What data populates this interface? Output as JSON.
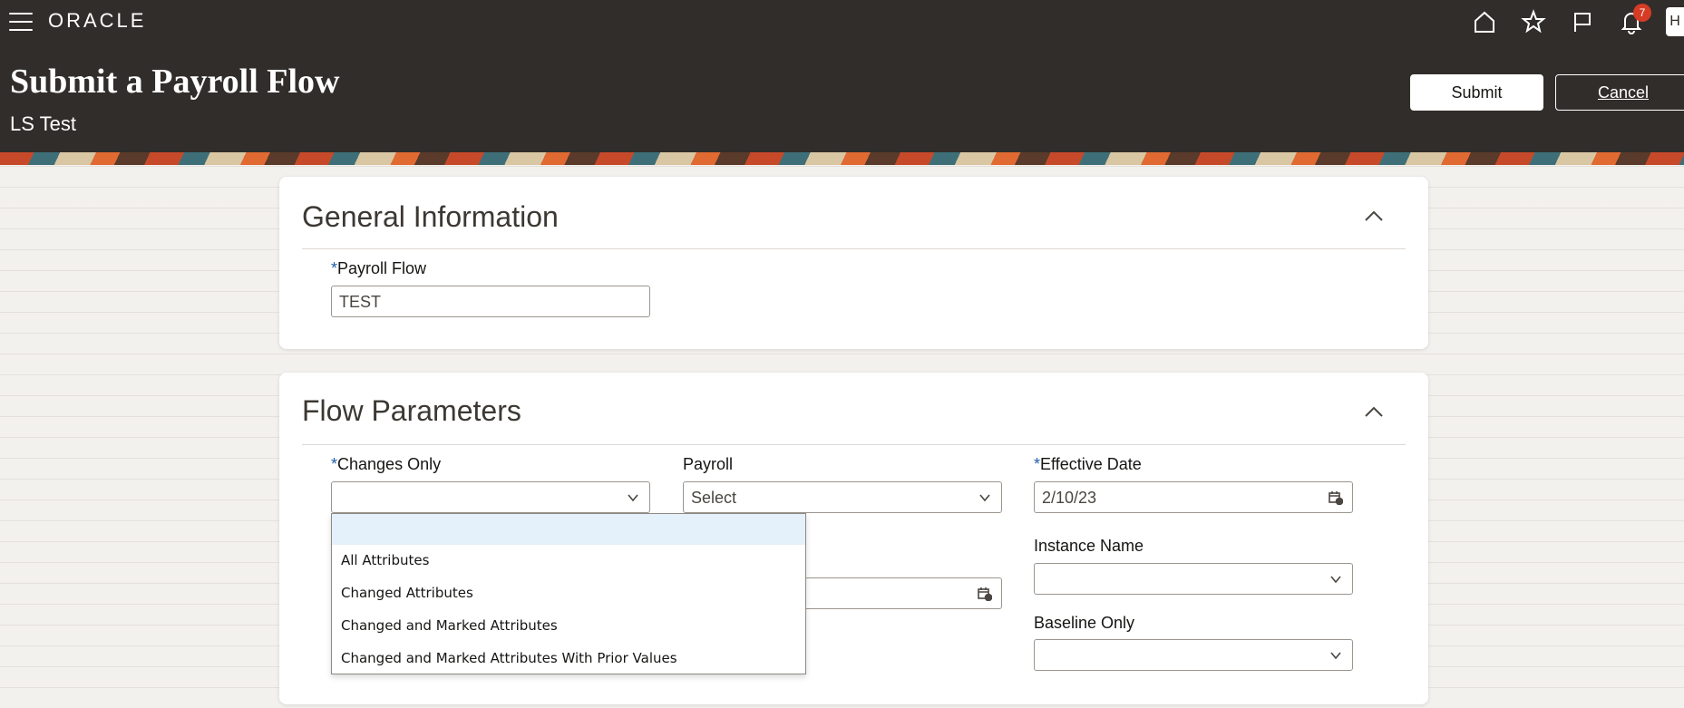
{
  "header": {
    "brand": "ORACLE",
    "title": "Submit a Payroll Flow",
    "subtitle": "LS Test",
    "notification_count": "7",
    "avatar_initial": "H",
    "submit_label": "Submit",
    "cancel_label": "Cancel"
  },
  "general": {
    "title": "General Information",
    "payroll_flow_label": "Payroll Flow",
    "payroll_flow_value": "TEST"
  },
  "flow": {
    "title": "Flow Parameters",
    "changes_only_label": "Changes Only",
    "changes_only_value": "",
    "payroll_label": "Payroll",
    "payroll_placeholder": "Select",
    "effective_date_label": "Effective Date",
    "effective_date_value": "2/10/23",
    "instance_name_label": "Instance Name",
    "baseline_only_label": "Baseline Only",
    "required_mark": "*"
  },
  "dropdown": {
    "options": [
      "",
      "All Attributes",
      "Changed Attributes",
      "Changed and Marked Attributes",
      "Changed and Marked Attributes With Prior Values"
    ]
  },
  "colors": {
    "header_bg": "#312d2a",
    "required": "#1f5fa8",
    "badge": "#d63b25",
    "highlight": "#e4f0fa"
  }
}
